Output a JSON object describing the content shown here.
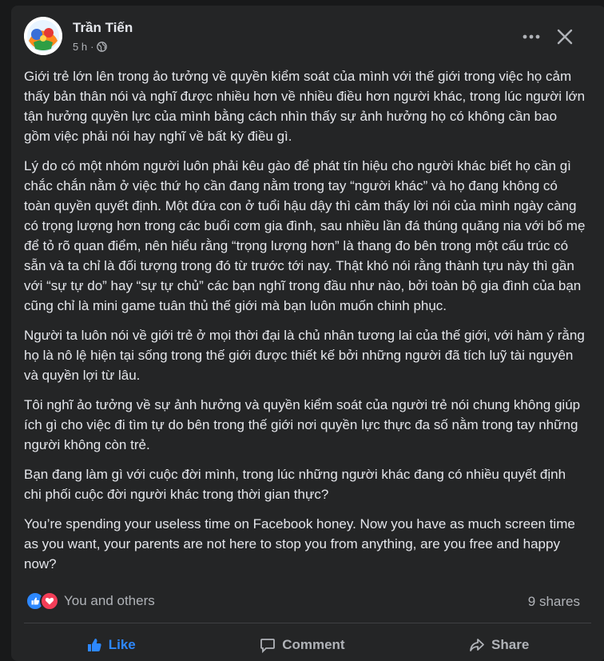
{
  "post": {
    "author": "Trần Tiến",
    "time": "5 h",
    "separator": "·",
    "paragraphs": [
      "Giới trẻ lớn lên trong ảo tưởng về quyền kiểm soát của mình với thế giới trong việc họ cảm thấy bản thân nói và nghĩ được nhiều hơn về nhiều điều hơn người khác, trong lúc người lớn tận hưởng quyền lực của mình bằng cách nhìn thấy sự ảnh hưởng họ có không cần bao gồm việc phải nói hay nghĩ về bất kỳ điều gì.",
      "Lý do có một nhóm người luôn phải kêu gào để phát tín hiệu cho người khác biết họ cần gì chắc chắn nằm ở việc thứ họ cần đang nằm trong tay “người khác” và họ đang không có toàn quyền quyết định. Một đứa con ở tuổi hậu dậy thì cảm thấy lời nói của mình ngày càng có trọng lượng hơn trong các buổi cơm gia đình, sau nhiều lần đá thúng quăng nia với bố mẹ để tỏ rõ quan điểm, nên hiểu rằng “trọng lượng hơn” là thang đo bên trong một cấu trúc có sẵn và ta chỉ là đối tượng trong đó từ trước tới nay. Thật khó nói rằng thành tựu này thì gần với “sự tự do” hay “sự tự chủ” các bạn nghĩ trong đầu như nào, bởi toàn bộ gia đình của bạn cũng chỉ là mini game tuân thủ thế giới mà bạn luôn muốn chinh phục.",
      "Người ta luôn nói về giới trẻ ở mọi thời đại là chủ nhân tương lai của thế giới, với hàm ý rằng họ là nô lệ hiện tại sống trong thế giới được thiết kế bởi những người đã tích luỹ tài nguyên và quyền lợi từ lâu.",
      "Tôi nghĩ ảo tưởng về sự ảnh hưởng và quyền kiểm soát của người trẻ nói chung không giúp ích gì cho việc đi tìm tự do bên trong thế giới nơi quyền lực thực đa số nằm trong tay những người không còn trẻ.",
      "Bạn đang làm gì với cuộc đời mình, trong lúc những người khác đang có nhiều quyết định chi phối cuộc đời người khác trong thời gian thực?",
      "You’re spending your useless time on Facebook honey. Now you have as much screen time as you want, your parents are not here to stop you from anything, are you free and happy now?"
    ],
    "reactions_text": "You and others",
    "shares_text": "9 shares"
  },
  "actions": {
    "like": "Like",
    "comment": "Comment",
    "share": "Share"
  },
  "colors": {
    "background": "#18191a",
    "card": "#242526",
    "text": "#e4e6eb",
    "secondary": "#b0b3b8",
    "like_blue": "#2d88ff",
    "love_red": "#f33e58"
  },
  "icons": [
    "avatar",
    "globe-icon",
    "more-icon",
    "close-icon",
    "like-reaction-icon",
    "love-reaction-icon",
    "like-icon",
    "comment-icon",
    "share-icon"
  ]
}
